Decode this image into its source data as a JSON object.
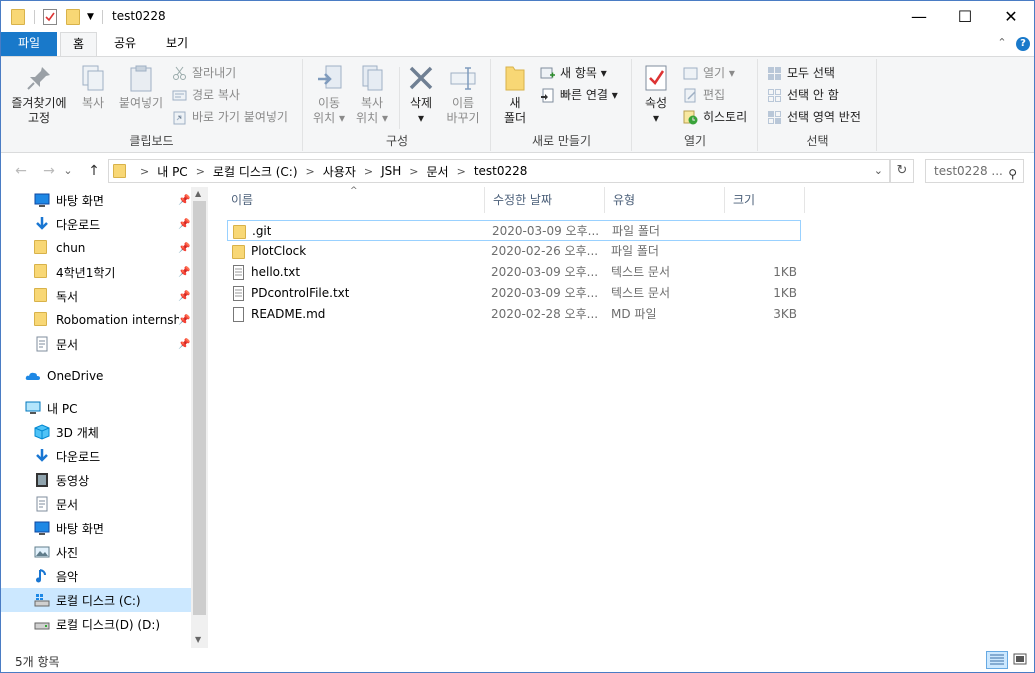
{
  "window": {
    "title": "test0228",
    "minimize": "—",
    "maximize": "☐",
    "close": "✕"
  },
  "tabs": {
    "file": "파일",
    "home": "홈",
    "share": "공유",
    "view": "보기",
    "collapse": "⌃",
    "help": "?"
  },
  "ribbon": {
    "clipboard": {
      "label": "클립보드",
      "pin_quick": "즐겨찾기에",
      "pin_quick2": "고정",
      "copy": "복사",
      "paste": "붙여넣기",
      "cut": "잘라내기",
      "copy_path": "경로 복사",
      "paste_shortcut": "바로 가기 붙여넣기"
    },
    "organize": {
      "label": "구성",
      "move_to": "이동",
      "move_to2": "위치",
      "copy_to": "복사",
      "copy_to2": "위치",
      "delete": "삭제",
      "rename": "이름",
      "rename2": "바꾸기"
    },
    "new": {
      "label": "새로 만들기",
      "new_folder": "새",
      "new_folder2": "폴더",
      "new_item": "새 항목",
      "easy_access": "빠른 연결"
    },
    "open": {
      "label": "열기",
      "properties": "속성",
      "open": "열기",
      "edit": "편집",
      "history": "히스토리"
    },
    "select": {
      "label": "선택",
      "select_all": "모두 선택",
      "select_none": "선택 안 함",
      "invert": "선택 영역 반전"
    }
  },
  "address": {
    "back": "←",
    "forward": "→",
    "recent": "⌄",
    "up": "↑",
    "crumbs": [
      "내 PC",
      "로컬 디스크 (C:)",
      "사용자",
      "JSH",
      "문서",
      "test0228"
    ],
    "dropdown": "⌄",
    "refresh": "↻",
    "search_placeholder": "test0228 ...",
    "search_icon": "⚲"
  },
  "nav": {
    "items": [
      {
        "label": "바탕 화면",
        "icon": "desktop-icon",
        "pinned": true
      },
      {
        "label": "다운로드",
        "icon": "download-icon",
        "pinned": true
      },
      {
        "label": "chun",
        "icon": "folder-icon",
        "pinned": true
      },
      {
        "label": "4학년1학기",
        "icon": "folder-icon",
        "pinned": true
      },
      {
        "label": "독서",
        "icon": "folder-icon",
        "pinned": true
      },
      {
        "label": "Robomation internship",
        "icon": "folder-icon",
        "pinned": true
      },
      {
        "label": "문서",
        "icon": "documents-icon",
        "pinned": true
      },
      {
        "label": "OneDrive",
        "icon": "onedrive-icon",
        "pinned": false
      },
      {
        "label": "내 PC",
        "icon": "this-pc-icon",
        "pinned": false
      },
      {
        "label": "3D 개체",
        "icon": "3d-objects-icon",
        "pinned": false
      },
      {
        "label": "다운로드",
        "icon": "download-icon",
        "pinned": false
      },
      {
        "label": "동영상",
        "icon": "videos-icon",
        "pinned": false
      },
      {
        "label": "문서",
        "icon": "documents-icon",
        "pinned": false
      },
      {
        "label": "바탕 화면",
        "icon": "desktop-icon",
        "pinned": false
      },
      {
        "label": "사진",
        "icon": "pictures-icon",
        "pinned": false
      },
      {
        "label": "음악",
        "icon": "music-icon",
        "pinned": false
      },
      {
        "label": "로컬 디스크 (C:)",
        "icon": "drive-c-icon",
        "pinned": false,
        "selected": true
      },
      {
        "label": "로컬 디스크(D) (D:)",
        "icon": "drive-icon",
        "pinned": false
      }
    ],
    "pin_glyph": "📌"
  },
  "columns": {
    "name": "이름",
    "modified": "수정한 날짜",
    "type": "유형",
    "size": "크기",
    "sort_indicator": "^"
  },
  "files": [
    {
      "name": ".git",
      "modified": "2020-03-09 오후...",
      "type": "파일 폴더",
      "size": "",
      "kind": "folder"
    },
    {
      "name": "PlotClock",
      "modified": "2020-02-26 오후...",
      "type": "파일 폴더",
      "size": "",
      "kind": "folder"
    },
    {
      "name": "hello.txt",
      "modified": "2020-03-09 오후...",
      "type": "텍스트 문서",
      "size": "1KB",
      "kind": "file"
    },
    {
      "name": "PDcontrolFile.txt",
      "modified": "2020-03-09 오후...",
      "type": "텍스트 문서",
      "size": "1KB",
      "kind": "file"
    },
    {
      "name": "README.md",
      "modified": "2020-02-28 오후...",
      "type": "MD 파일",
      "size": "3KB",
      "kind": "file"
    }
  ],
  "status": {
    "count": "5개 항목"
  },
  "colors": {
    "accent": "#1979ca",
    "selection": "#cce8ff",
    "folder": "#f8d775"
  }
}
